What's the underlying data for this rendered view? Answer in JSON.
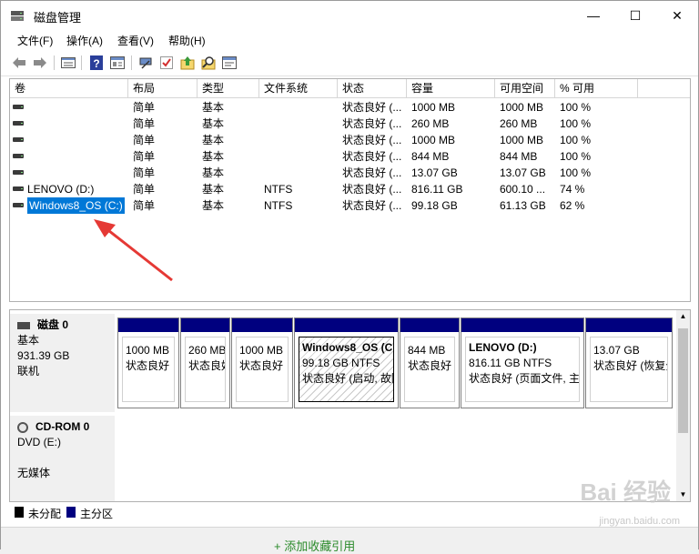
{
  "window": {
    "title": "磁盘管理",
    "minimize": "—",
    "maximize": "☐",
    "close": "✕"
  },
  "menu": [
    "文件(F)",
    "操作(A)",
    "查看(V)",
    "帮助(H)"
  ],
  "toolbar": {
    "icons": [
      "back-icon",
      "forward-icon",
      "list-icon",
      "help-icon",
      "properties-icon",
      "connect-icon",
      "check-icon",
      "up-icon",
      "search-icon",
      "console-icon"
    ]
  },
  "volume_table": {
    "headers": [
      "卷",
      "布局",
      "类型",
      "文件系统",
      "状态",
      "容量",
      "可用空间",
      "% 可用"
    ],
    "rows": [
      [
        "",
        "简单",
        "基本",
        "",
        "状态良好 (...",
        "1000 MB",
        "1000 MB",
        "100 %"
      ],
      [
        "",
        "简单",
        "基本",
        "",
        "状态良好 (...",
        "260 MB",
        "260 MB",
        "100 %"
      ],
      [
        "",
        "简单",
        "基本",
        "",
        "状态良好 (...",
        "1000 MB",
        "1000 MB",
        "100 %"
      ],
      [
        "",
        "简单",
        "基本",
        "",
        "状态良好 (...",
        "844 MB",
        "844 MB",
        "100 %"
      ],
      [
        "",
        "简单",
        "基本",
        "",
        "状态良好 (...",
        "13.07 GB",
        "13.07 GB",
        "100 %"
      ],
      [
        "LENOVO (D:)",
        "简单",
        "基本",
        "NTFS",
        "状态良好 (...",
        "816.11 GB",
        "600.10 ...",
        "74 %"
      ],
      [
        "Windows8_OS (C:)",
        "简单",
        "基本",
        "NTFS",
        "状态良好 (...",
        "99.18 GB",
        "61.13 GB",
        "62 %"
      ]
    ]
  },
  "disk0": {
    "name": "磁盘 0",
    "type": "基本",
    "size": "931.39 GB",
    "status": "联机",
    "partitions": [
      {
        "line1": "",
        "line2": "1000 MB",
        "line3": "状态良好"
      },
      {
        "line1": "",
        "line2": "260 MB",
        "line3": "状态良好"
      },
      {
        "line1": "",
        "line2": "1000 MB",
        "line3": "状态良好"
      },
      {
        "line1": "Windows8_OS  (C:)",
        "line2": "99.18 GB NTFS",
        "line3": "状态良好 (启动, 故障"
      },
      {
        "line1": "",
        "line2": "844 MB",
        "line3": "状态良好"
      },
      {
        "line1": "LENOVO  (D:)",
        "line2": "816.11 GB NTFS",
        "line3": "状态良好 (页面文件, 主"
      },
      {
        "line1": "",
        "line2": "13.07 GB",
        "line3": "状态良好 (恢复分"
      }
    ]
  },
  "cdrom0": {
    "name": "CD-ROM 0",
    "type": "DVD (E:)",
    "status": "无媒体"
  },
  "legend": {
    "unallocated": "未分配",
    "primary": "主分区"
  },
  "colors": {
    "primary_partition": "#00007f",
    "unallocated": "#000000",
    "selection": "#0078d7",
    "annotation_arrow": "#e53935"
  },
  "bottom_text": "+ 添加收藏引用",
  "watermark": {
    "line1": "Bai 经验",
    "line2": "jingyan.baidu.com"
  }
}
